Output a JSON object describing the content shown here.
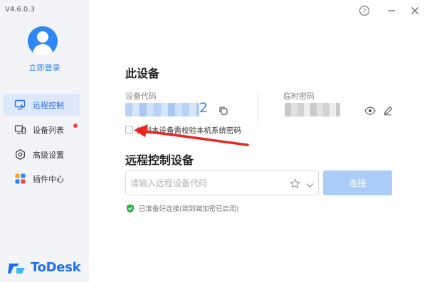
{
  "app": {
    "version": "V4.6.0.3",
    "brand": "ToDesk",
    "accent_color": "#2f86f6"
  },
  "window_controls": [
    {
      "name": "help-icon",
      "glyph": "?"
    },
    {
      "name": "minimize-icon",
      "glyph": "—"
    },
    {
      "name": "close-icon",
      "glyph": "✕"
    }
  ],
  "sidebar": {
    "login_label": "立即登录",
    "items": [
      {
        "label": "远程控制",
        "icon": "remote-control-icon",
        "active": true
      },
      {
        "label": "设备列表",
        "icon": "device-list-icon",
        "badge": "red-dot"
      },
      {
        "label": "高级设置",
        "icon": "settings-icon"
      },
      {
        "label": "插件中心",
        "icon": "plugin-center-icon"
      }
    ]
  },
  "this_device": {
    "title": "此设备",
    "code_label": "设备代码",
    "code_visible_tail": "2",
    "temp_password_label": "临时密码",
    "require_password_checkbox_label": "控制本设备需校验本机系统密码",
    "require_password_checked": false
  },
  "remote_control": {
    "title": "远程控制设备",
    "input_placeholder": "请输入远程设备代码",
    "input_value": "",
    "connect_label": "连接",
    "status_text": "已准备好连接(端到端加密已启用)",
    "status_color": "#2bb24c"
  },
  "annotation": {
    "arrow_color": "#e6261f"
  }
}
